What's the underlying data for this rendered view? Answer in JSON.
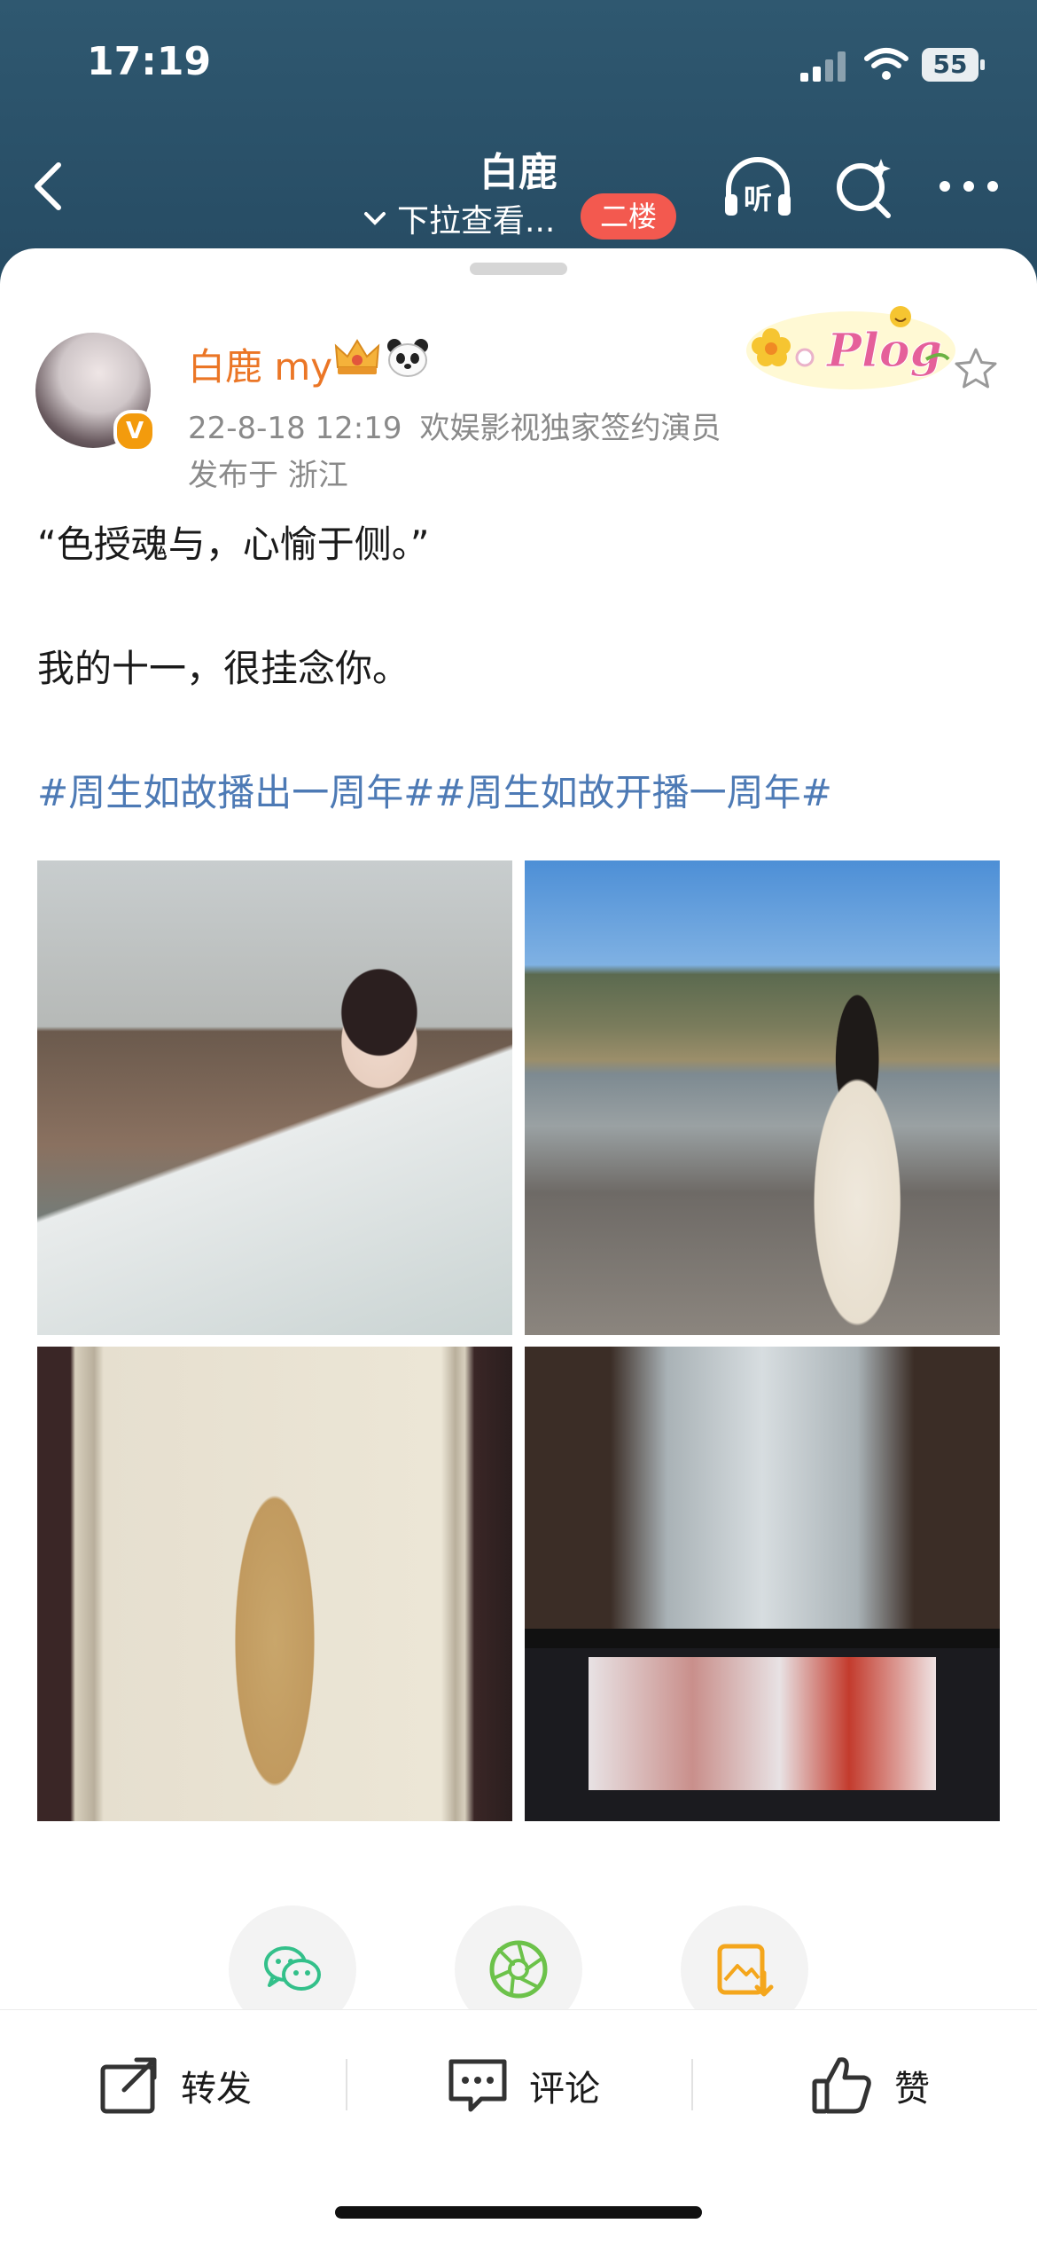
{
  "status_bar": {
    "time": "17:19",
    "battery": "55"
  },
  "nav": {
    "title": "白鹿",
    "subtitle": "下拉查看...",
    "floor_badge": "二楼",
    "listen_label": "听"
  },
  "post": {
    "author": "白鹿 my",
    "verified_mark": "V",
    "timestamp": "22-8-18 12:19",
    "author_title": "欢娱影视独家签约演员",
    "location": "发布于 浙江",
    "sticker_text": "Plog",
    "line1": "“色授魂与，心愉于侧。”",
    "line2": "我的十一，很挂念你。",
    "hashtags": "#周生如故播出一周年##周生如故开播一周年#"
  },
  "actions": {
    "repost": "转发",
    "comment": "评论",
    "like": "赞"
  },
  "colors": {
    "header": "#2f5870",
    "author": "#eb7626",
    "hashtag": "#4d7ab5",
    "badge": "#f3594f"
  }
}
